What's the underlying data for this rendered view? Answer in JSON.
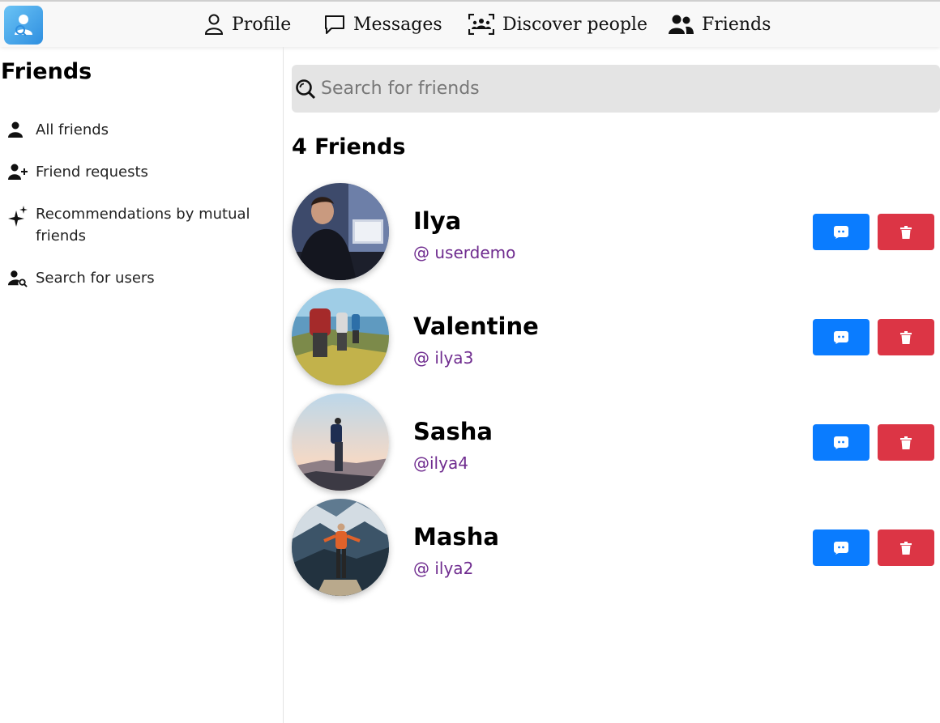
{
  "nav": {
    "profile": "Profile",
    "messages": "Messages",
    "discover": "Discover people",
    "friends": "Friends"
  },
  "sidebar": {
    "title": "Friends",
    "items": [
      {
        "label": "All friends",
        "icon": "user-icon"
      },
      {
        "label": "Friend requests",
        "icon": "user-plus-icon"
      },
      {
        "label": "Recommendations by mutual friends",
        "icon": "sparkles-icon"
      },
      {
        "label": "Search for users",
        "icon": "user-search-icon"
      }
    ]
  },
  "search": {
    "placeholder": "Search for friends"
  },
  "friends_count_label": "4 Friends",
  "friends": [
    {
      "name": "Ilya",
      "handle": "@ userdemo"
    },
    {
      "name": "Valentine",
      "handle": "@ ilya3"
    },
    {
      "name": "Sasha",
      "handle": "@ilya4"
    },
    {
      "name": "Masha",
      "handle": "@ ilya2"
    }
  ],
  "colors": {
    "message_button": "#0a7cff",
    "delete_button": "#dc3545",
    "handle_text": "#6f2c8f",
    "search_bg": "#e4e4e4"
  }
}
